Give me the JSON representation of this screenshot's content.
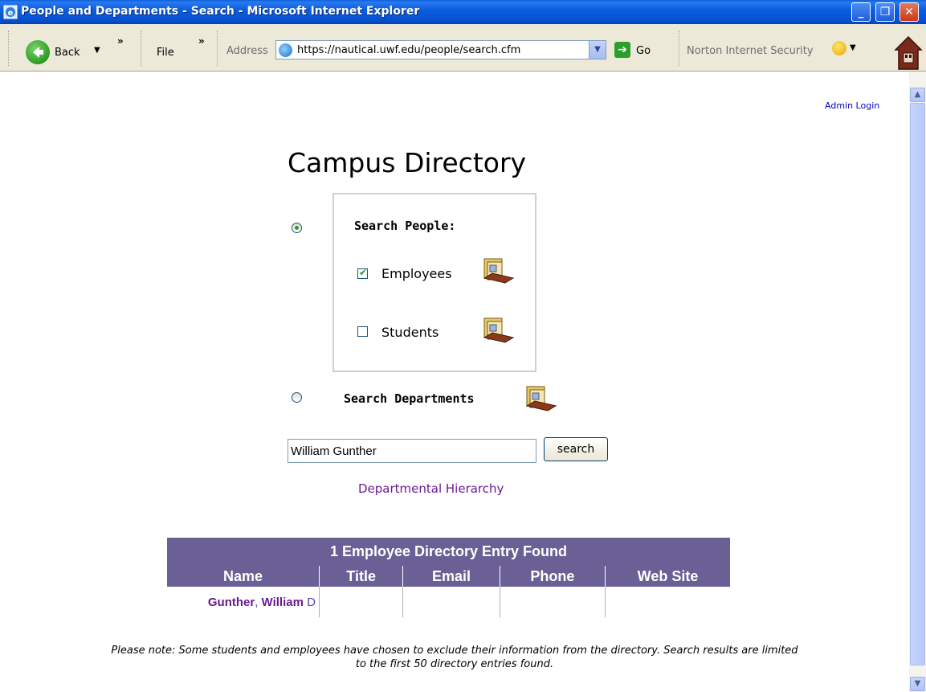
{
  "window": {
    "title": "People and Departments - Search - Microsoft Internet Explorer"
  },
  "toolbar": {
    "back_label": "Back",
    "file_label": "File",
    "address_label": "Address",
    "address_url": "https://nautical.uwf.edu/people/search.cfm",
    "go_label": "Go",
    "norton_label": "Norton Internet Security"
  },
  "page": {
    "admin_login": "Admin Login",
    "title": "Campus Directory",
    "search_people_label": "Search People:",
    "employees_label": "Employees",
    "employees_checked": true,
    "students_label": "Students",
    "students_checked": false,
    "search_departments_label": "Search Departments",
    "selected_mode": "people",
    "search_value": "William Gunther",
    "search_button": "search",
    "hierarchy_link": "Departmental Hierarchy"
  },
  "results": {
    "caption": "1 Employee Directory Entry Found",
    "columns": [
      "Name",
      "Title",
      "Email",
      "Phone",
      "Web Site"
    ],
    "rows": [
      {
        "last": "Gunther",
        "sep": ", ",
        "first": "William",
        "middle": " D",
        "title": "",
        "email": "",
        "phone": "",
        "web": ""
      }
    ]
  },
  "note": {
    "line1": "Please note: Some students and employees have chosen to exclude their information from the directory. Search results are limited",
    "line2": "to the first 50 directory entries found."
  },
  "colors": {
    "table_header": "#6a6096",
    "link_visited": "#6a1a90",
    "titlebar": "#0a5fd8"
  }
}
